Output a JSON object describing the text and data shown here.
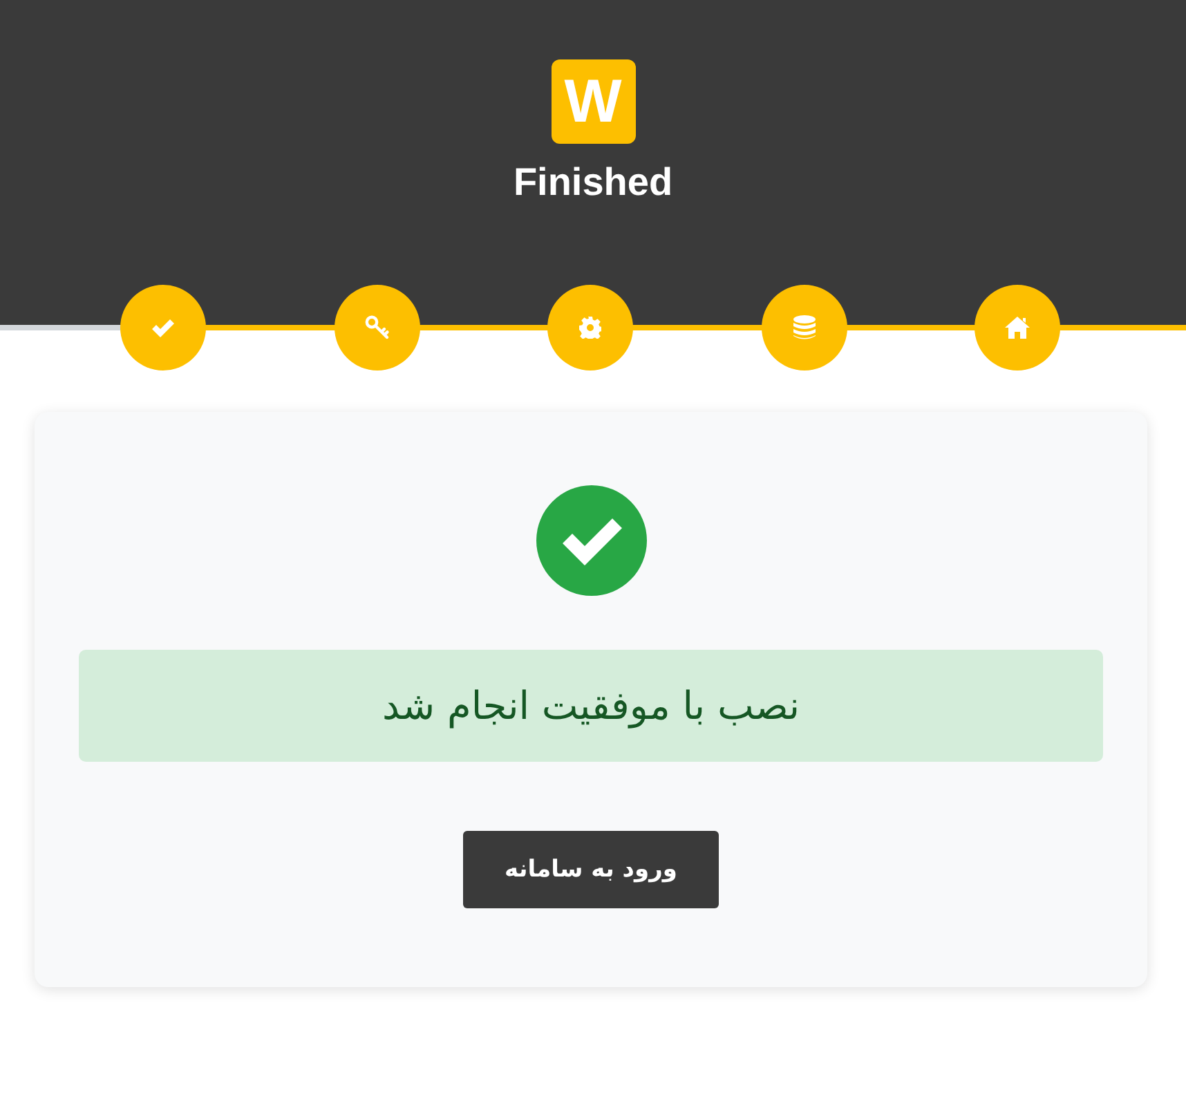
{
  "header": {
    "logo_letter": "W",
    "title": "Finished"
  },
  "progress": {
    "level": 0.86
  },
  "steps": [
    {
      "kind": "home",
      "done": true
    },
    {
      "kind": "database",
      "done": true
    },
    {
      "kind": "gear",
      "done": true
    },
    {
      "kind": "key",
      "done": true
    },
    {
      "kind": "check",
      "done": true
    }
  ],
  "card": {
    "kind": "success",
    "message": "نصب با موفقیت انجام شد",
    "button": "ورود به سامانه"
  }
}
